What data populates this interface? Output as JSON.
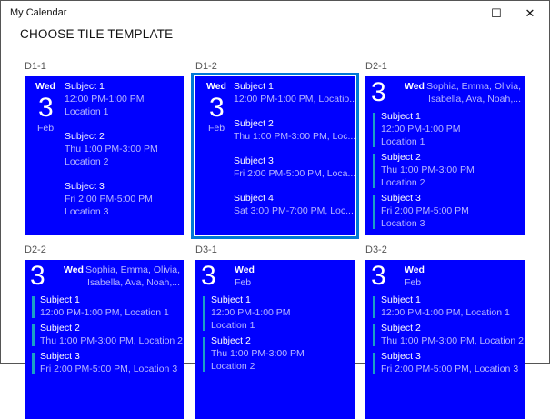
{
  "window": {
    "title": "My Calendar",
    "minimize": "—",
    "maximize": "☐",
    "close": "✕"
  },
  "page": {
    "heading": "CHOOSE TILE TEMPLATE"
  },
  "colors": {
    "tile": "#0000ff",
    "accent": "#0078d7",
    "bar": "#1ba1c6"
  },
  "tiles": [
    {
      "label": "D1-1",
      "day": "Wed",
      "date": "3",
      "month": "Feb",
      "events": [
        {
          "subject": "Subject 1",
          "lines": [
            "12:00 PM-1:00 PM",
            "Location 1"
          ]
        },
        {
          "subject": "Subject 2",
          "lines": [
            "Thu 1:00 PM-3:00 PM",
            "Location 2"
          ]
        },
        {
          "subject": "Subject 3",
          "lines": [
            "Fri 2:00 PM-5:00 PM",
            "Location 3"
          ]
        }
      ]
    },
    {
      "label": "D1-2",
      "selected": true,
      "day": "Wed",
      "date": "3",
      "month": "Feb",
      "events": [
        {
          "subject": "Subject 1",
          "lines": [
            "12:00 PM-1:00 PM, Locatio..."
          ]
        },
        {
          "subject": "Subject 2",
          "lines": [
            "Thu 1:00 PM-3:00 PM, Loc..."
          ]
        },
        {
          "subject": "Subject 3",
          "lines": [
            "Fri 2:00 PM-5:00 PM, Loca..."
          ]
        },
        {
          "subject": "Subject 4",
          "lines": [
            "Sat 3:00 PM-7:00 PM, Loc..."
          ]
        }
      ]
    },
    {
      "label": "D2-1",
      "day": "Wed",
      "date": "3",
      "attendees": [
        "Sophia, Emma, Olivia,",
        "Isabella, Ava, Noah,..."
      ],
      "events": [
        {
          "subject": "Subject 1",
          "lines": [
            "12:00 PM-1:00 PM",
            "Location 1"
          ]
        },
        {
          "subject": "Subject 2",
          "lines": [
            "Thu 1:00 PM-3:00 PM",
            "Location 2"
          ]
        },
        {
          "subject": "Subject 3",
          "lines": [
            "Fri 2:00 PM-5:00 PM",
            "Location 3"
          ]
        }
      ]
    },
    {
      "label": "D2-2",
      "day": "Wed",
      "date": "3",
      "attendees": [
        "Sophia, Emma, Olivia,",
        "Isabella, Ava, Noah,..."
      ],
      "events": [
        {
          "subject": "Subject 1",
          "lines": [
            "12:00 PM-1:00 PM, Location 1"
          ]
        },
        {
          "subject": "Subject 2",
          "lines": [
            "Thu 1:00 PM-3:00 PM, Location 2"
          ]
        },
        {
          "subject": "Subject 3",
          "lines": [
            "Fri 2:00 PM-5:00 PM, Location 3"
          ]
        }
      ]
    },
    {
      "label": "D3-1",
      "day": "Wed",
      "date": "3",
      "month": "Feb",
      "events": [
        {
          "subject": "Subject 1",
          "lines": [
            "12:00 PM-1:00 PM",
            "Location 1"
          ]
        },
        {
          "subject": "Subject 2",
          "lines": [
            "Thu 1:00 PM-3:00 PM",
            "Location 2"
          ]
        }
      ]
    },
    {
      "label": "D3-2",
      "day": "Wed",
      "date": "3",
      "month": "Feb",
      "events": [
        {
          "subject": "Subject 1",
          "lines": [
            "12:00 PM-1:00 PM, Location 1"
          ]
        },
        {
          "subject": "Subject 2",
          "lines": [
            "Thu 1:00 PM-3:00 PM, Location 2"
          ]
        },
        {
          "subject": "Subject 3",
          "lines": [
            "Fri 2:00 PM-5:00 PM, Location 3"
          ]
        }
      ]
    }
  ]
}
